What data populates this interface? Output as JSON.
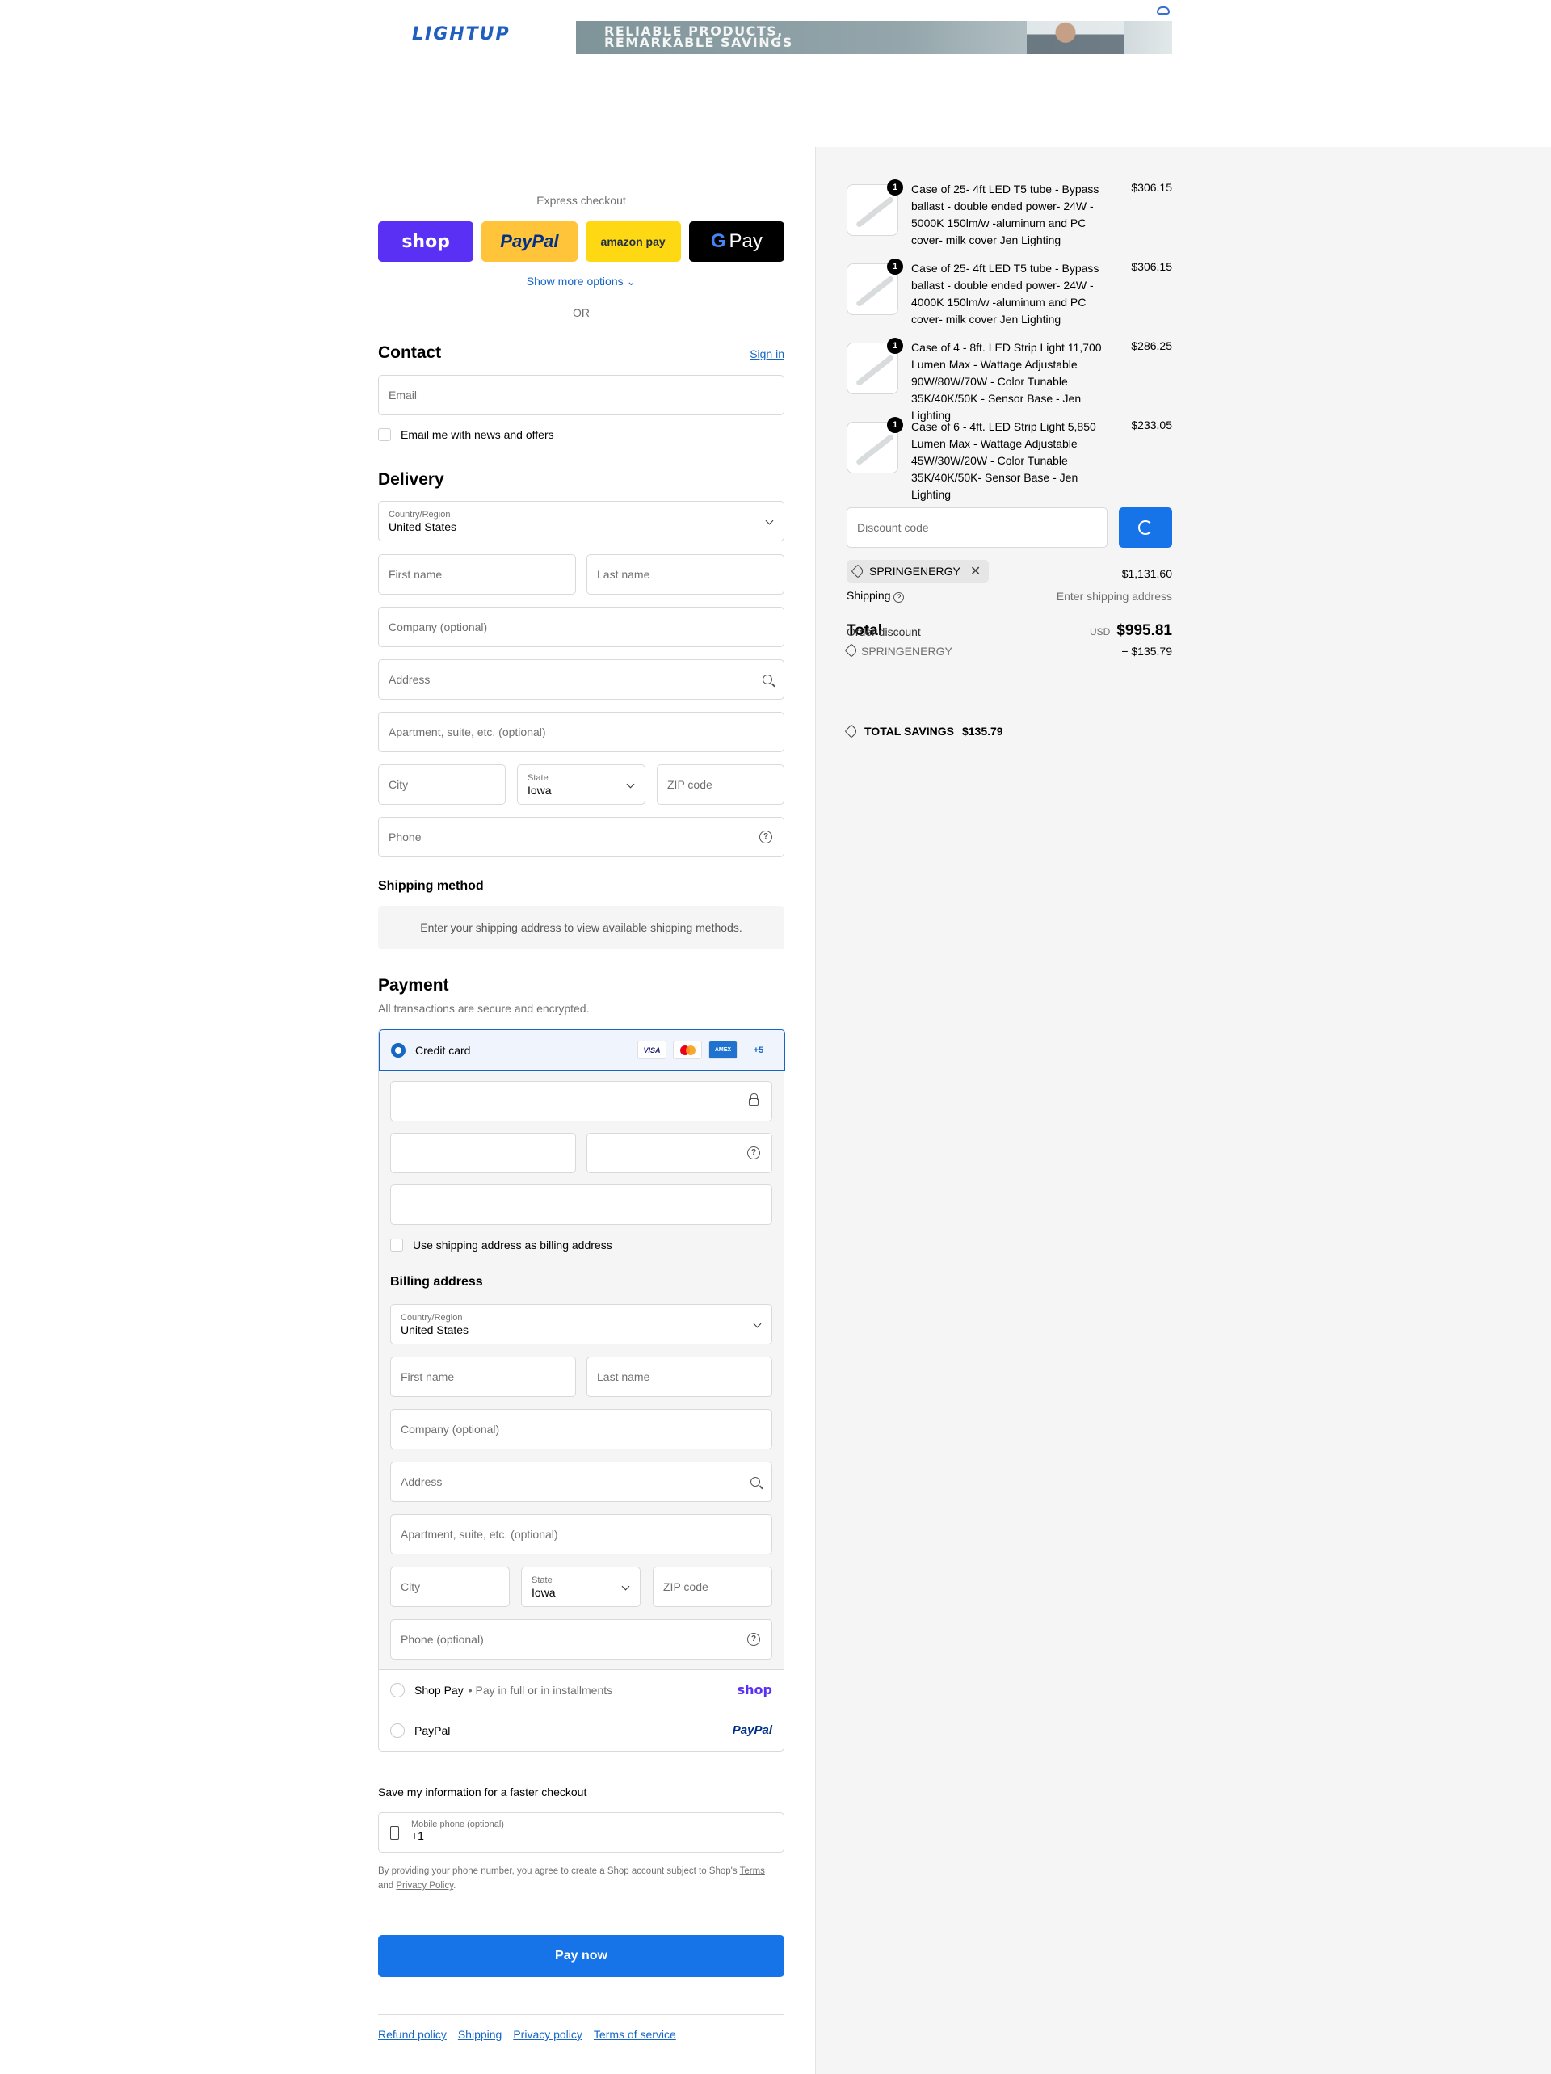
{
  "brand": {
    "logo_text": "LIGHTUP",
    "banner_line1": "RELIABLE PRODUCTS,",
    "banner_line2": "REMARKABLE SAVINGS"
  },
  "express": {
    "title": "Express checkout",
    "buttons": [
      "shop",
      "PayPal",
      "amazon pay",
      "Pay"
    ],
    "show_more": "Show more options",
    "or": "OR"
  },
  "contact": {
    "title": "Contact",
    "sign_in": "Sign in",
    "email_placeholder": "Email",
    "news_checkbox": "Email me with news and offers"
  },
  "delivery": {
    "title": "Delivery",
    "country_label": "Country/Region",
    "country_value": "United States",
    "first_name": "First name",
    "last_name": "Last name",
    "company": "Company (optional)",
    "address": "Address",
    "apartment": "Apartment, suite, etc. (optional)",
    "city": "City",
    "state_label": "State",
    "state_value": "Iowa",
    "zip": "ZIP code",
    "phone": "Phone"
  },
  "shipping_method": {
    "title": "Shipping method",
    "note": "Enter your shipping address to view available shipping methods."
  },
  "payment": {
    "title": "Payment",
    "subtitle": "All transactions are secure and encrypted.",
    "credit_card_label": "Credit card",
    "card_brands": [
      "VISA",
      "Mastercard",
      "AMEX",
      "+5"
    ],
    "use_shipping_checkbox": "Use shipping address as billing address",
    "billing_title": "Billing address",
    "billing": {
      "country_label": "Country/Region",
      "country_value": "United States",
      "first_name": "First name",
      "last_name": "Last name",
      "company": "Company (optional)",
      "address": "Address",
      "apartment": "Apartment, suite, etc. (optional)",
      "city": "City",
      "state_label": "State",
      "state_value": "Iowa",
      "zip": "ZIP code",
      "phone": "Phone (optional)"
    },
    "shop_pay": {
      "name": "Shop Pay",
      "separator": "•",
      "desc": "Pay in full or in installments",
      "brand": "shop"
    },
    "paypal": {
      "name": "PayPal",
      "brand": "PayPal"
    }
  },
  "save_info": {
    "title": "Save my information for a faster checkout",
    "mobile_label": "Mobile phone (optional)",
    "mobile_value": "+1",
    "legal_before": "By providing your phone number, you agree to create a Shop account subject to Shop's",
    "legal_terms": "Terms",
    "legal_and": "and",
    "legal_privacy": "Privacy Policy",
    "legal_end": "."
  },
  "pay_now": "Pay now",
  "footer_links": [
    "Refund policy",
    "Shipping",
    "Privacy policy",
    "Terms of service"
  ],
  "order": {
    "items": [
      {
        "qty": "1",
        "name": "Case of 25- 4ft LED T5 tube - Bypass ballast - double ended power- 24W - 5000K 150lm/w -aluminum and PC cover- milk cover Jen Lighting",
        "price": "$306.15"
      },
      {
        "qty": "1",
        "name": "Case of 25- 4ft LED T5 tube - Bypass ballast - double ended power- 24W - 4000K 150lm/w -aluminum and PC cover- milk cover Jen Lighting",
        "price": "$306.15"
      },
      {
        "qty": "1",
        "name": "Case of 4 - 8ft. LED Strip Light 11,700 Lumen Max - Wattage Adjustable 90W/80W/70W - Color Tunable 35K/40K/50K - Sensor Base - Jen Lighting",
        "price": "$286.25"
      },
      {
        "qty": "1",
        "name": "Case of 6 - 4ft. LED Strip Light 5,850 Lumen Max - Wattage Adjustable 45W/30W/20W - Color Tunable 35K/40K/50K- Sensor Base - Jen Lighting",
        "price": "$233.05"
      }
    ],
    "discount_placeholder": "Discount code",
    "applied_code": "SPRINGENERGY",
    "subtotal_value": "$1,131.60",
    "shipping_label": "Shipping",
    "shipping_value": "Enter shipping address",
    "total_label": "Total",
    "total_currency": "USD",
    "total_value": "$995.81",
    "order_discount_label": "Order discount",
    "discount_code_line": "SPRINGENERGY",
    "discount_value": "− $135.79",
    "savings_label": "TOTAL SAVINGS",
    "savings_value": "$135.79"
  }
}
